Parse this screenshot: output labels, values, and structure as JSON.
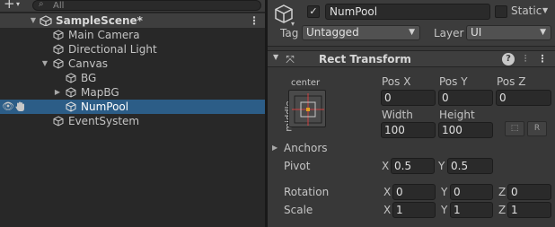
{
  "hierarchy": {
    "add_label": "+",
    "search_placeholder": "All",
    "scene": {
      "name": "SampleScene*",
      "menu": "⋮"
    },
    "items": [
      {
        "name": "Main Camera"
      },
      {
        "name": "Directional Light"
      },
      {
        "name": "Canvas"
      },
      {
        "name": "BG"
      },
      {
        "name": "MapBG"
      },
      {
        "name": "NumPool"
      },
      {
        "name": "EventSystem"
      }
    ]
  },
  "inspector": {
    "object": {
      "name": "NumPool",
      "active": true,
      "static_label": "Static",
      "tag_label": "Tag",
      "tag_value": "Untagged",
      "layer_label": "Layer",
      "layer_value": "UI"
    },
    "component": {
      "title": "Rect Transform",
      "anchor_h": "center",
      "anchor_v": "middle",
      "labels": {
        "pos_x": "Pos X",
        "pos_y": "Pos Y",
        "pos_z": "Pos Z",
        "width": "Width",
        "height": "Height"
      },
      "values": {
        "pos_x": "0",
        "pos_y": "0",
        "pos_z": "0",
        "width": "100",
        "height": "100"
      },
      "raw_edit_btn": "R",
      "anchors_label": "Anchors",
      "pivot": {
        "label": "Pivot",
        "x_axis": "X",
        "x": "0.5",
        "y_axis": "Y",
        "y": "0.5"
      },
      "rotation": {
        "label": "Rotation",
        "x_axis": "X",
        "x": "0",
        "y_axis": "Y",
        "y": "0",
        "z_axis": "Z",
        "z": "0"
      },
      "scale": {
        "label": "Scale",
        "x_axis": "X",
        "x": "1",
        "y_axis": "Y",
        "y": "1",
        "z_axis": "Z",
        "z": "1"
      }
    }
  },
  "colors": {
    "selection": "#2c5d87",
    "field_bg": "#2a2a2a",
    "panel_bg": "#383838",
    "hierarchy_bg": "#282828"
  }
}
